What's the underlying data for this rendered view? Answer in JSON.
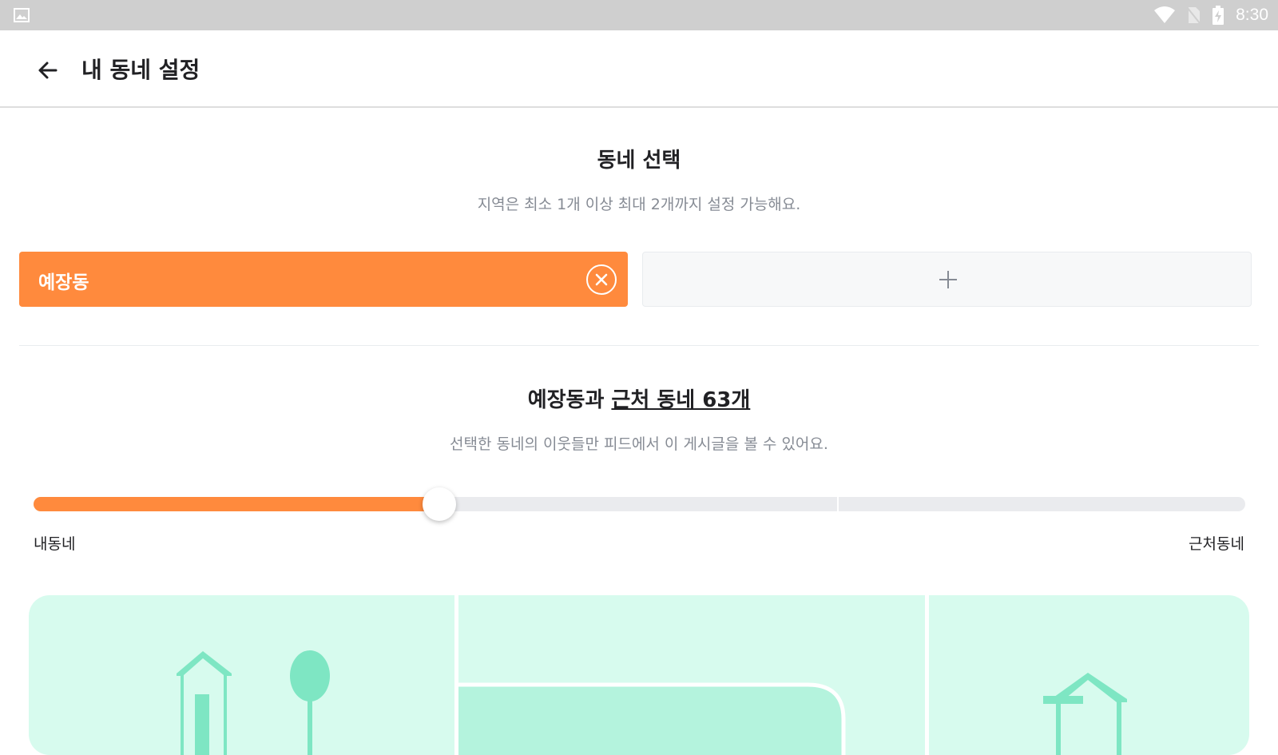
{
  "status_bar": {
    "time": "8:30",
    "icons": [
      "image-icon",
      "wifi-icon",
      "no-sim-icon",
      "battery-charging-icon"
    ]
  },
  "app_bar": {
    "title": "내 동네 설정",
    "back_icon": "arrow-left-icon"
  },
  "select_section": {
    "title": "동네 선택",
    "description": "지역은 최소 1개 이상 최대 2개까지 설정 가능해요."
  },
  "neighborhoods": {
    "selected": "예장동",
    "remove_icon": "close-circle-icon",
    "add_icon": "plus-icon"
  },
  "range_section": {
    "title_prefix": "예장동과 ",
    "title_link": "근처 동네 63개",
    "description": "선택한 동네의 이웃들만 피드에서 이 게시글을 볼 수 있어요.",
    "slider_level": 0.335,
    "min_label": "내동네",
    "max_label": "근처동네"
  },
  "colors": {
    "accent": "#ff8a3d",
    "map_background": "#d7fbee",
    "map_illustration": "#7ee6c3"
  }
}
